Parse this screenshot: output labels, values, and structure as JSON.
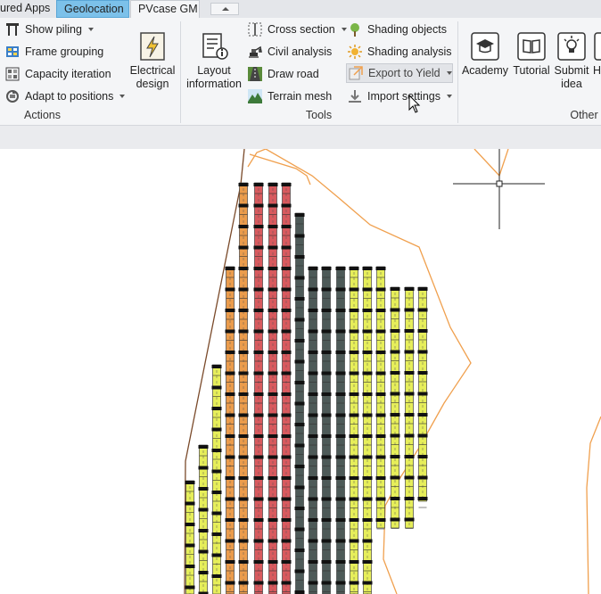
{
  "tabs": {
    "featured": "ured Apps",
    "geolocation": "Geolocation",
    "pvcase": "PVcase GM"
  },
  "actions": {
    "show_piling": "Show piling",
    "frame_grouping": "Frame grouping",
    "capacity_iteration": "Capacity iteration",
    "adapt_to_positions": "Adapt to positions",
    "electrical_design": [
      "Electrical",
      "design"
    ],
    "label": "Actions"
  },
  "tools": {
    "layout_information": [
      "Layout",
      "information"
    ],
    "cross_section": "Cross section",
    "civil_analysis": "Civil analysis",
    "draw_road": "Draw road",
    "terrain_mesh": "Terrain mesh",
    "shading_objects": "Shading objects",
    "shading_analysis": "Shading analysis",
    "export_to_yield": "Export to Yield",
    "import_settings": "Import settings",
    "label": "Tools"
  },
  "other": {
    "academy": "Academy",
    "tutorial": "Tutorial",
    "submit_idea": [
      "Submit",
      "idea"
    ],
    "partial": "H",
    "label": "Other"
  },
  "colors": {
    "orange": "#eb9c4c",
    "red": "#d85a5e",
    "gray": "#4d5a58",
    "yellow": "#e6ee5a",
    "boundary": "#f0a04e",
    "ribbon": "#f4f5f7"
  }
}
